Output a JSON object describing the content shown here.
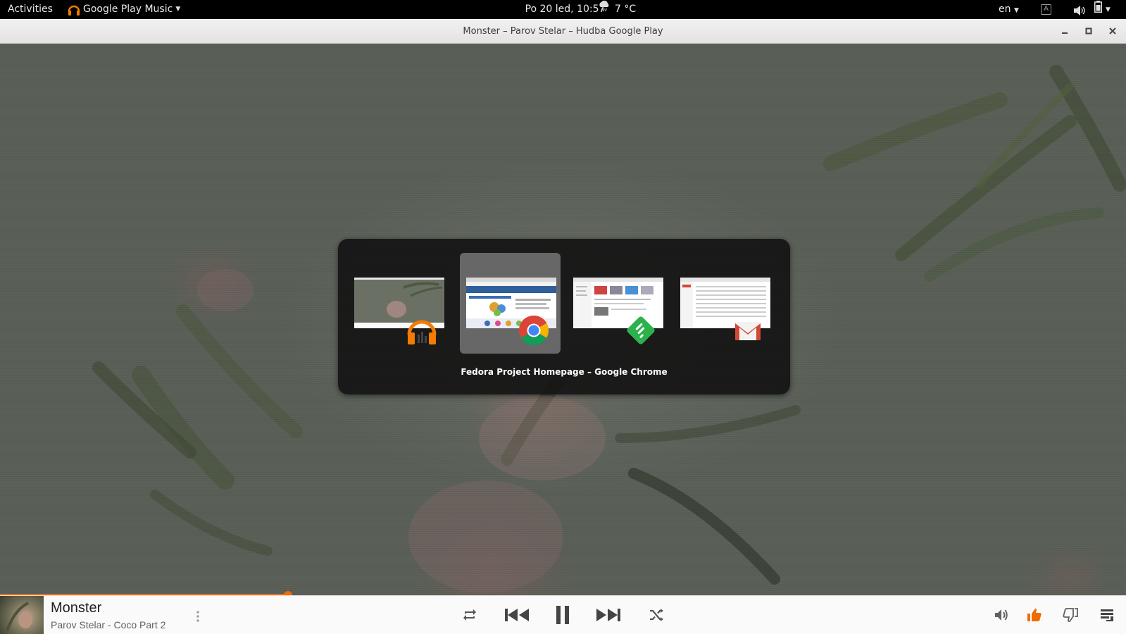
{
  "topbar": {
    "activities": "Activities",
    "app_menu": "Google Play Music",
    "clock": "Po 20 led, 10:57",
    "weather": "7 °C",
    "language": "en"
  },
  "window": {
    "title": "Monster – Parov Stelar – Hudba Google Play"
  },
  "switcher": {
    "selected_label": "Fedora Project Homepage – Google Chrome",
    "items": [
      {
        "app": "Google Play Music",
        "icon": "headphones-icon",
        "selected": false
      },
      {
        "app": "Google Chrome",
        "icon": "chrome-icon",
        "selected": true
      },
      {
        "app": "Feedly",
        "icon": "feedly-icon",
        "selected": false
      },
      {
        "app": "Gmail",
        "icon": "gmail-icon",
        "selected": false
      }
    ]
  },
  "player": {
    "title": "Monster",
    "artist": "Parov Stelar - Coco Part 2",
    "progress": 0.256,
    "accent": "#ef6c00",
    "thumbs_up_active": true
  }
}
